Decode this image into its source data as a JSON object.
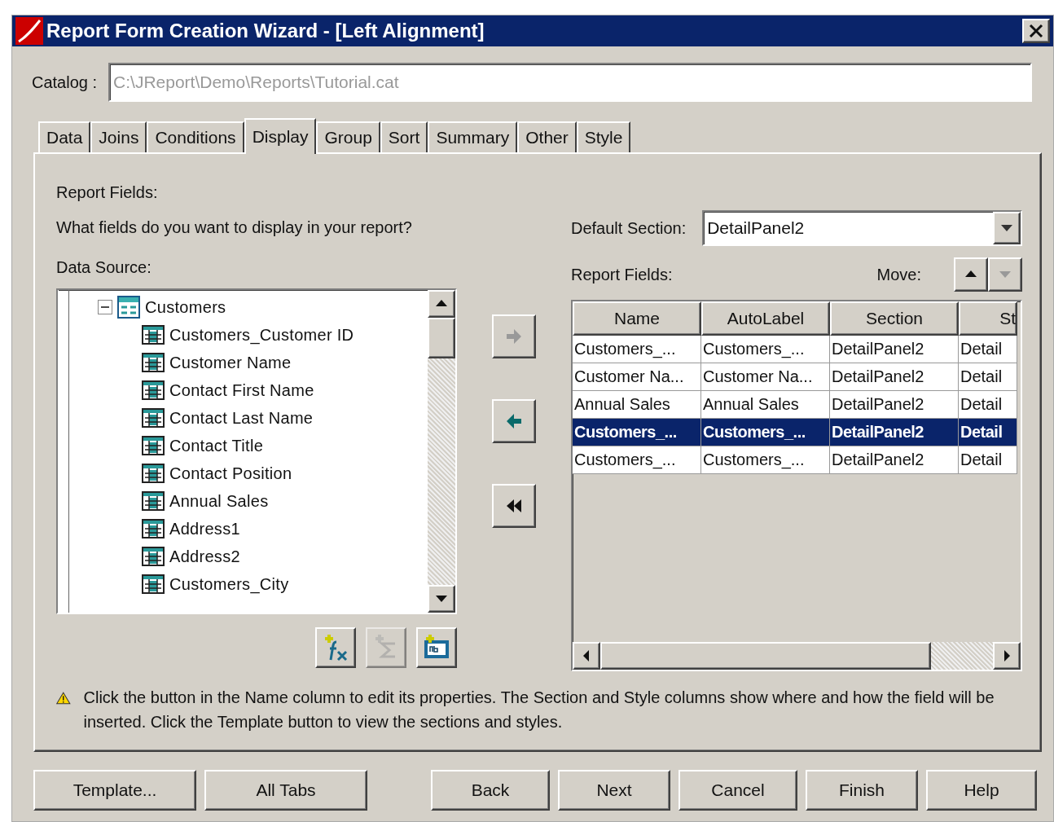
{
  "window": {
    "title": "Report Form Creation Wizard - [Left Alignment]"
  },
  "catalog": {
    "label": "Catalog :",
    "value": "C:\\JReport\\Demo\\Reports\\Tutorial.cat"
  },
  "tabs": [
    {
      "label": "Data",
      "selected": false
    },
    {
      "label": "Joins",
      "selected": false
    },
    {
      "label": "Conditions",
      "selected": false
    },
    {
      "label": "Display",
      "selected": true
    },
    {
      "label": "Group",
      "selected": false
    },
    {
      "label": "Sort",
      "selected": false
    },
    {
      "label": "Summary",
      "selected": false
    },
    {
      "label": "Other",
      "selected": false
    },
    {
      "label": "Style",
      "selected": false
    }
  ],
  "heading": "Report Fields:",
  "question": "What fields do you want to display in your report?",
  "data_source": {
    "label": "Data Source:",
    "tree": [
      {
        "label": "Customers",
        "expanded": true,
        "children": [
          {
            "label": "Customers_Customer ID"
          },
          {
            "label": "Customer Name"
          },
          {
            "label": "Contact First Name"
          },
          {
            "label": "Contact Last Name"
          },
          {
            "label": "Contact Title"
          },
          {
            "label": "Contact Position"
          },
          {
            "label": "Annual Sales"
          },
          {
            "label": "Address1"
          },
          {
            "label": "Address2"
          },
          {
            "label": "Customers_City"
          }
        ]
      }
    ]
  },
  "transfer_buttons": [
    {
      "kind": "add",
      "disabled": true
    },
    {
      "kind": "remove",
      "disabled": false
    },
    {
      "kind": "remove_all",
      "disabled": false
    }
  ],
  "tool_buttons": [
    {
      "kind": "formula",
      "disabled": false
    },
    {
      "kind": "summary",
      "disabled": true
    },
    {
      "kind": "label",
      "disabled": false
    }
  ],
  "default_section": {
    "label": "Default Section:",
    "value": "DetailPanel2"
  },
  "report_fields": {
    "label": "Report Fields:",
    "move_label": "Move:",
    "move_up_disabled": false,
    "move_down_disabled": true,
    "columns": [
      "Name",
      "AutoLabel",
      "Section",
      "St"
    ],
    "rows": [
      {
        "cells": [
          "Customers_...",
          "Customers_...",
          "DetailPanel2",
          "Detail"
        ],
        "selected": false
      },
      {
        "cells": [
          "Customer Na...",
          "Customer Na...",
          "DetailPanel2",
          "Detail"
        ],
        "selected": false
      },
      {
        "cells": [
          "Annual Sales",
          "Annual Sales",
          "DetailPanel2",
          "Detail"
        ],
        "selected": false
      },
      {
        "cells": [
          "Customers_...",
          "Customers_...",
          "DetailPanel2",
          "Detail"
        ],
        "selected": true
      },
      {
        "cells": [
          "Customers_...",
          "Customers_...",
          "DetailPanel2",
          "Detail"
        ],
        "selected": false
      }
    ]
  },
  "hint": "Click the button in the Name column to edit its properties. The Section and Style columns show where and how the field will be inserted. Click the Template button to view the sections and styles.",
  "buttons": [
    "Template...",
    "All Tabs",
    "Back",
    "Next",
    "Cancel",
    "Finish",
    "Help"
  ]
}
